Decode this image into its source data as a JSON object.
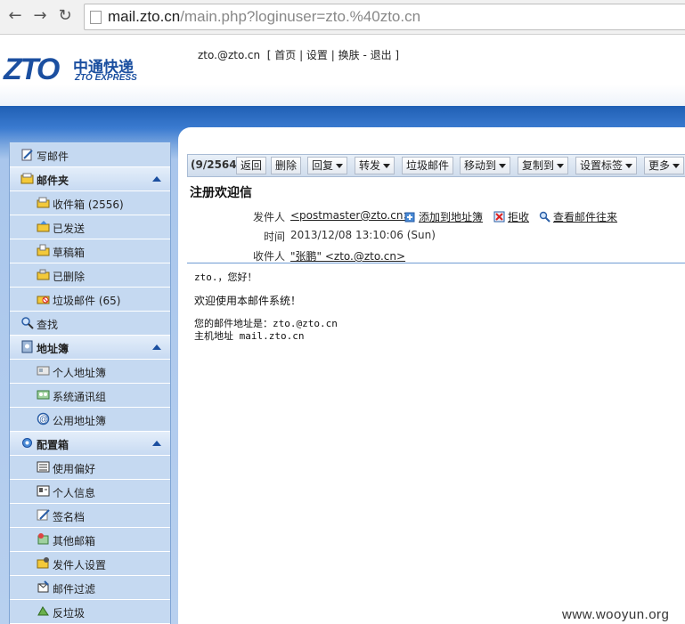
{
  "browser": {
    "url_host": "mail.zto.cn",
    "url_path": "/main.php?loginuser=zto.%40zto.cn"
  },
  "header": {
    "logo_mark": "ZTO",
    "logo_cn": "中通快递",
    "logo_en": "ZTO EXPRESS",
    "user_email": "zto.@zto.cn",
    "links": [
      "首页",
      "设置",
      "换肤",
      "退出"
    ]
  },
  "sidebar": {
    "items": [
      {
        "label": "写邮件",
        "type": "item-top",
        "icon": "compose-icon"
      },
      {
        "label": "邮件夹",
        "type": "section",
        "icon": "folder-icon"
      },
      {
        "label": "收件箱 (2556)",
        "type": "sub",
        "icon": "inbox-icon"
      },
      {
        "label": "已发送",
        "type": "sub",
        "icon": "sent-icon"
      },
      {
        "label": "草稿箱",
        "type": "sub",
        "icon": "drafts-icon"
      },
      {
        "label": "已删除",
        "type": "sub",
        "icon": "trash-icon"
      },
      {
        "label": "垃圾邮件 (65)",
        "type": "sub",
        "icon": "spam-icon"
      },
      {
        "label": "查找",
        "type": "item-top",
        "icon": "search-icon"
      },
      {
        "label": "地址簿",
        "type": "section",
        "icon": "addressbook-icon"
      },
      {
        "label": "个人地址簿",
        "type": "sub",
        "icon": "contacts-icon"
      },
      {
        "label": "系统通讯组",
        "type": "sub",
        "icon": "group-icon"
      },
      {
        "label": "公用地址簿",
        "type": "sub",
        "icon": "at-icon"
      },
      {
        "label": "配置箱",
        "type": "section",
        "icon": "gear-icon"
      },
      {
        "label": "使用偏好",
        "type": "sub",
        "icon": "preferences-icon"
      },
      {
        "label": "个人信息",
        "type": "sub",
        "icon": "idcard-icon"
      },
      {
        "label": "签名档",
        "type": "sub",
        "icon": "signature-icon"
      },
      {
        "label": "其他邮箱",
        "type": "sub",
        "icon": "other-mailbox-icon"
      },
      {
        "label": "发件人设置",
        "type": "sub",
        "icon": "sender-settings-icon"
      },
      {
        "label": "邮件过滤",
        "type": "sub",
        "icon": "filter-icon"
      },
      {
        "label": "反垃圾",
        "type": "sub",
        "icon": "antispam-icon"
      }
    ]
  },
  "toolbar": {
    "count": "(9/2564)",
    "buttons": [
      {
        "label": "返回",
        "dropdown": false
      },
      {
        "label": "删除",
        "dropdown": false
      },
      {
        "label": "回复",
        "dropdown": true
      },
      {
        "label": "转发",
        "dropdown": true
      },
      {
        "label": "垃圾邮件",
        "dropdown": false
      },
      {
        "label": "移动到",
        "dropdown": true
      },
      {
        "label": "复制到",
        "dropdown": true
      },
      {
        "label": "设置标签",
        "dropdown": true
      },
      {
        "label": "更多",
        "dropdown": true
      }
    ]
  },
  "message": {
    "subject": "注册欢迎信",
    "from_label": "发件人",
    "from_value": "<postmaster@zto.cn>",
    "action_add": "添加到地址簿",
    "action_reject": "拒收",
    "action_history": "查看邮件往来",
    "time_label": "时间",
    "time_value": "2013/12/08 13:10:06 (Sun)",
    "to_label": "收件人",
    "to_value": "\"张鹏\" <zto.@zto.cn>",
    "body": {
      "greeting": "zto.，您好！",
      "welcome": "欢迎使用本邮件系统！",
      "addr_line": "您的邮件地址是：zto.@zto.cn",
      "host_line": "主机地址 mail.zto.cn"
    }
  },
  "watermark": "www.wooyun.org",
  "colors": {
    "brand_blue": "#1b4fa0",
    "sidebar_bg": "#c5d9f1",
    "band_top": "#1f5fb4"
  }
}
